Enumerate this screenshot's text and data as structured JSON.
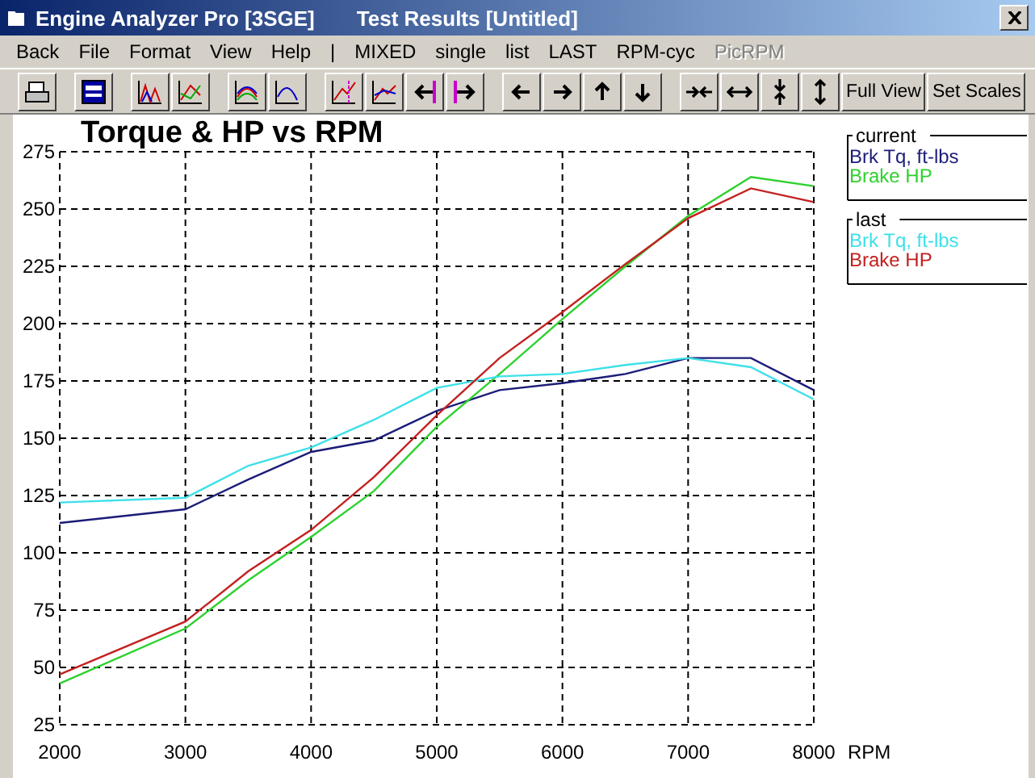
{
  "window": {
    "title": "Engine Analyzer Pro [3SGE]",
    "subtitle": "Test Results [Untitled]"
  },
  "menu": [
    {
      "label": "Back",
      "disabled": false
    },
    {
      "label": "File",
      "disabled": false
    },
    {
      "label": "Format",
      "disabled": false
    },
    {
      "label": "View",
      "disabled": false
    },
    {
      "label": "Help",
      "disabled": false
    },
    {
      "label": "|",
      "disabled": false
    },
    {
      "label": "MIXED",
      "disabled": false
    },
    {
      "label": "single",
      "disabled": false
    },
    {
      "label": "list",
      "disabled": false
    },
    {
      "label": "LAST",
      "disabled": false
    },
    {
      "label": "RPM-cyc",
      "disabled": false
    },
    {
      "label": "PicRPM",
      "disabled": true
    }
  ],
  "toolbar": [
    [
      {
        "kind": "print"
      }
    ],
    [
      {
        "kind": "window"
      }
    ],
    [
      {
        "kind": "peaks"
      },
      {
        "kind": "lines"
      }
    ],
    [
      {
        "kind": "curves"
      },
      {
        "kind": "curve"
      }
    ],
    [
      {
        "kind": "cursor"
      },
      {
        "kind": "cursor2"
      },
      {
        "kind": "prev"
      },
      {
        "kind": "next"
      }
    ],
    [
      {
        "kind": "left"
      },
      {
        "kind": "right"
      },
      {
        "kind": "up"
      },
      {
        "kind": "down"
      }
    ],
    [
      {
        "kind": "hin"
      },
      {
        "kind": "hout"
      },
      {
        "kind": "vin"
      },
      {
        "kind": "vout"
      },
      {
        "kind": "text",
        "label": "Full View"
      },
      {
        "kind": "text",
        "label": "Set Scales"
      }
    ]
  ],
  "chart": {
    "chart_data": {
      "type": "line",
      "grid": true,
      "title": "Torque & HP vs RPM",
      "xlabel": "RPM",
      "x": [
        2000,
        3000,
        3500,
        4000,
        4500,
        5000,
        5500,
        6000,
        6500,
        7000,
        7500,
        8000
      ],
      "xlim": [
        2000,
        8000
      ],
      "ylim": [
        25,
        275
      ],
      "xticks": [
        2000,
        3000,
        4000,
        5000,
        6000,
        7000,
        8000
      ],
      "yticks": [
        25,
        50,
        75,
        100,
        125,
        150,
        175,
        200,
        225,
        250,
        275
      ],
      "series": [
        {
          "name": "Brk Tq, ft-lbs",
          "color": "#1c1c78",
          "values": [
            113,
            119,
            132,
            144,
            149,
            162,
            171,
            174,
            178,
            185,
            185,
            171
          ]
        },
        {
          "name": "Brake HP",
          "color": "#2ed12e",
          "values": [
            43,
            67,
            88,
            107,
            127,
            155,
            178,
            202,
            225,
            247,
            264,
            260
          ]
        },
        {
          "name": "Brk Tq, ft-lbs",
          "color": "#3ee0e8",
          "values": [
            122,
            124,
            138,
            146,
            158,
            172,
            177,
            178,
            182,
            185,
            181,
            167
          ]
        },
        {
          "name": "Brake HP",
          "color": "#c42020",
          "values": [
            47,
            70,
            92,
            110,
            133,
            160,
            185,
            205,
            226,
            246,
            259,
            253
          ]
        }
      ]
    },
    "legend": [
      {
        "label": "current"
      },
      {
        "label": "last"
      }
    ]
  }
}
